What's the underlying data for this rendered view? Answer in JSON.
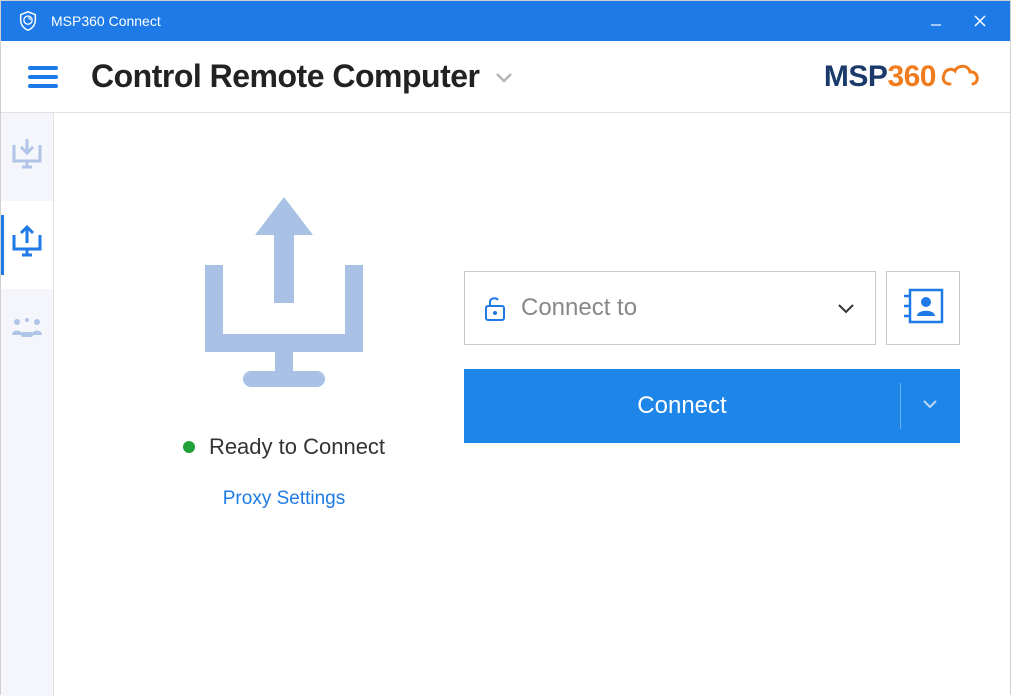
{
  "titlebar": {
    "app_title": "MSP360 Connect"
  },
  "header": {
    "page_title": "Control Remote Computer",
    "brand_part1": "MSP",
    "brand_part2": "360"
  },
  "sidebar": {
    "items": [
      {
        "name": "incoming",
        "active": false
      },
      {
        "name": "outgoing",
        "active": true
      },
      {
        "name": "meetings",
        "active": false
      }
    ]
  },
  "main": {
    "status_text": "Ready to Connect",
    "status_color": "#1fa038",
    "proxy_link": "Proxy Settings",
    "connect_placeholder": "Connect to",
    "connect_value": "",
    "connect_button": "Connect"
  },
  "colors": {
    "primary": "#1e7ae6",
    "button": "#1e86e8",
    "orange": "#f07c1e",
    "navy": "#1a3a6b"
  }
}
